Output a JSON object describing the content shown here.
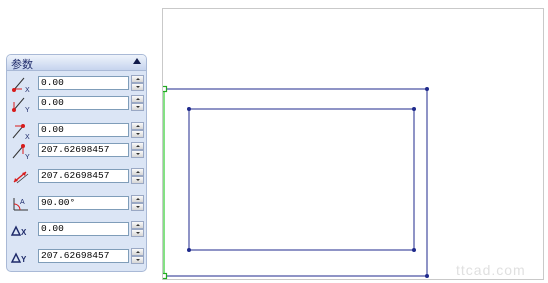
{
  "panel": {
    "title": "参数",
    "fields": [
      {
        "icon": "start-x-icon",
        "value": "0.00"
      },
      {
        "icon": "start-y-icon",
        "value": "0.00"
      },
      {
        "icon": "end-x-icon",
        "value": "0.00"
      },
      {
        "icon": "end-y-icon",
        "value": "207.62698457"
      },
      {
        "icon": "length-icon",
        "value": "207.62698457"
      },
      {
        "icon": "angle-icon",
        "value": "90.00°"
      },
      {
        "icon": "delta-x-icon",
        "value": "0.00"
      },
      {
        "icon": "delta-y-icon",
        "value": "207.62698457"
      }
    ]
  },
  "colors": {
    "rectangle_outline": "#1f2a8c",
    "selected_line": "#33cc33",
    "endpoint_marker": "#22aa22",
    "icon_red": "#d81b1b"
  },
  "watermark": "ttcad.com"
}
